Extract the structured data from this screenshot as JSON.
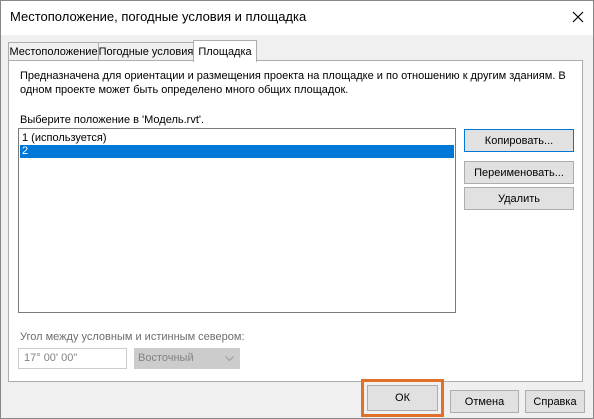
{
  "dialog": {
    "title": "Местоположение, погодные условия и площадка",
    "tabs": [
      {
        "label": "Местоположение"
      },
      {
        "label": "Погодные условия"
      },
      {
        "label": "Площадка"
      }
    ],
    "description": "Предназначена для ориентации и размещения проекта на площадке и по отношению к другим зданиям. В одном проекте может быть определено много общих площадок.",
    "select_label": "Выберите положение в 'Модель.rvt'.",
    "positions": [
      "1 (используется)",
      "2"
    ],
    "selected_index": 1,
    "buttons": {
      "copy": "Копировать...",
      "rename": "Переименовать...",
      "delete": "Удалить",
      "ok": "ОК",
      "cancel": "Отмена",
      "help": "Справка"
    },
    "angle": {
      "label": "Угол между условным и истинным севером:",
      "value": "17° 00' 00\"",
      "direction": "Восточный"
    }
  },
  "colors": {
    "selection": "#0078d7",
    "highlight": "#e0702a"
  }
}
